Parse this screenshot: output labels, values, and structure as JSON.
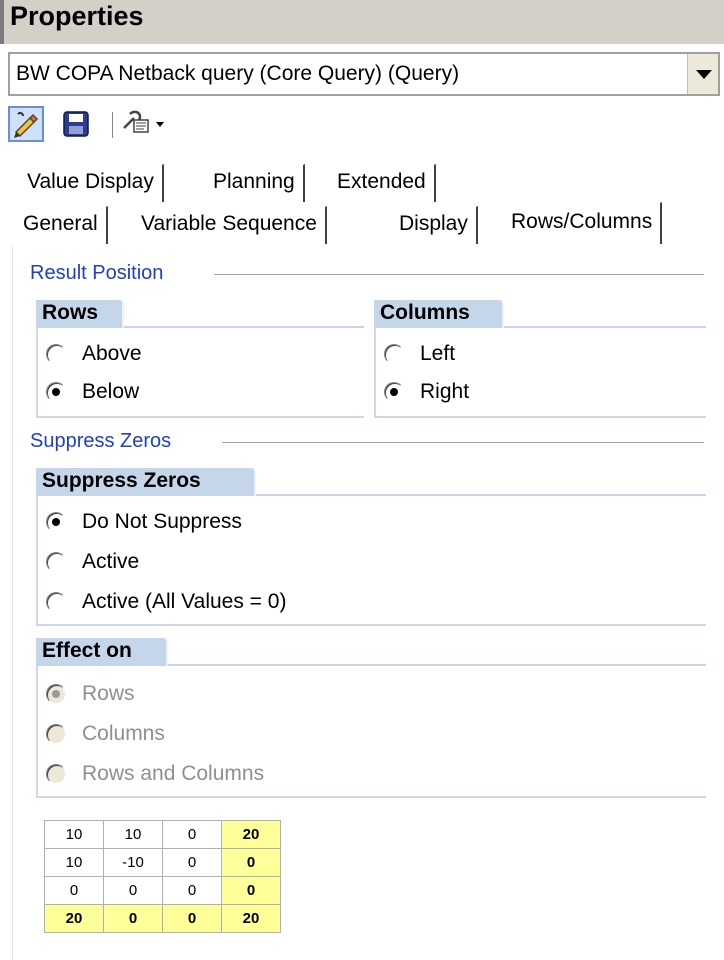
{
  "window": {
    "title": "Properties"
  },
  "query_selector": {
    "value": "BW COPA Netback query (Core Query) (Query)"
  },
  "toolbar": {
    "icons": [
      "edit-pencil-icon",
      "save-icon",
      "tools-dropdown-icon"
    ]
  },
  "tabs": {
    "row1": [
      {
        "label": "Value Display"
      },
      {
        "label": "Planning"
      },
      {
        "label": "Extended"
      }
    ],
    "row2": [
      {
        "label": "General"
      },
      {
        "label": "Variable Sequence"
      },
      {
        "label": "Display"
      },
      {
        "label": "Rows/Columns",
        "active": true
      }
    ]
  },
  "result_position": {
    "title": "Result Position",
    "rows": {
      "header": "Rows",
      "options": [
        {
          "label": "Above",
          "checked": false
        },
        {
          "label": "Below",
          "checked": true
        }
      ]
    },
    "columns": {
      "header": "Columns",
      "options": [
        {
          "label": "Left",
          "checked": false
        },
        {
          "label": "Right",
          "checked": true
        }
      ]
    }
  },
  "suppress_zeros": {
    "title": "Suppress Zeros",
    "group": {
      "header": "Suppress Zeros",
      "options": [
        {
          "label": "Do Not Suppress",
          "checked": true
        },
        {
          "label": "Active",
          "checked": false
        },
        {
          "label": "Active (All Values = 0)",
          "checked": false
        }
      ]
    },
    "effect_on": {
      "header": "Effect on",
      "options": [
        {
          "label": "Rows",
          "checked": true,
          "disabled": true
        },
        {
          "label": "Columns",
          "checked": false,
          "disabled": true
        },
        {
          "label": "Rows and Columns",
          "checked": false,
          "disabled": true
        }
      ]
    }
  },
  "preview_table": {
    "rows": [
      [
        "10",
        "10",
        "0",
        "20"
      ],
      [
        "10",
        "-10",
        "0",
        "0"
      ],
      [
        "0",
        "0",
        "0",
        "0"
      ],
      [
        "20",
        "0",
        "0",
        "20"
      ]
    ],
    "highlight_color": "#ffff99"
  }
}
